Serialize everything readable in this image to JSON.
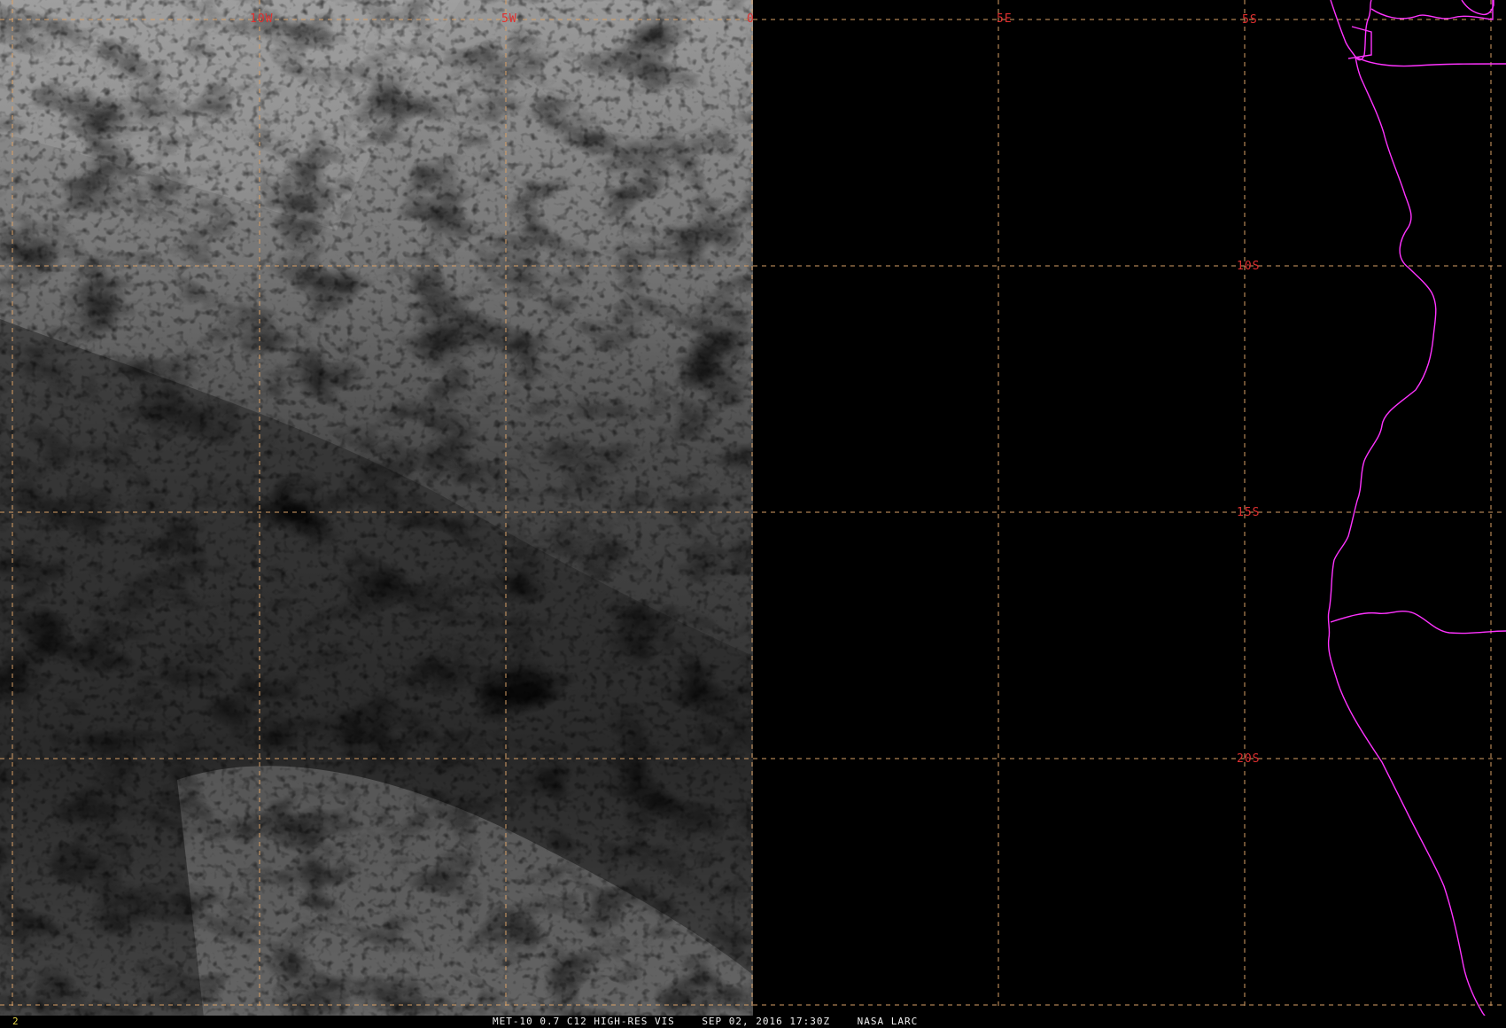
{
  "colors": {
    "grid": "#d9a066",
    "grid_label": "#e03030",
    "coastline": "#ff33ff",
    "caption": "#f2f2f2",
    "frame_number": "#e8d84a",
    "background": "#000000"
  },
  "map": {
    "projection": "satellite visible imagery",
    "longitude_labels": [
      "10W",
      "5W",
      "0",
      "5E"
    ],
    "latitude_labels": [
      "5S",
      "10S",
      "15S",
      "20S"
    ],
    "coastline": "Africa (Gabon / Congo / Angola / Namibia)",
    "cloud_field": "stratocumulus over South Atlantic, data left of 0° longitude"
  },
  "footer": {
    "frame_number": "2",
    "product": "MET-10 0.7 C12 HIGH-RES VIS",
    "datetime": "SEP 02, 2016 17:30Z",
    "source": "NASA LARC"
  }
}
